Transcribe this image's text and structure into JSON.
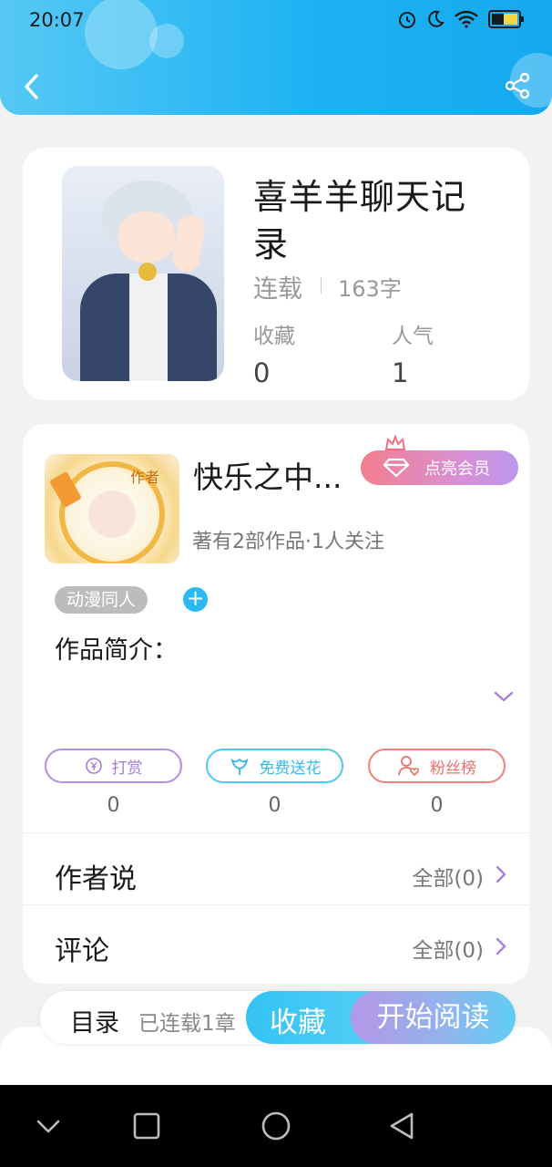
{
  "status_bar": {
    "time": "20:07"
  },
  "book": {
    "title": "喜羊羊聊天记录",
    "status": "连载",
    "word_count": "163字",
    "stats": [
      {
        "label": "收藏",
        "value": "0"
      },
      {
        "label": "人气",
        "value": "1"
      }
    ]
  },
  "author": {
    "name": "快乐之中...",
    "avatar_badge": "作者",
    "vip_label": "点亮会员",
    "meta": "著有2部作品·1人关注",
    "tag": "动漫同人",
    "add_tag_symbol": "+",
    "intro_label": "作品简介："
  },
  "actions": [
    {
      "label": "打赏",
      "count": "0",
      "color": "#a47cd6"
    },
    {
      "label": "免费送花",
      "count": "0",
      "color": "#35b8e6"
    },
    {
      "label": "粉丝榜",
      "count": "0",
      "color": "#ec706a"
    }
  ],
  "rows": [
    {
      "label": "作者说",
      "link": "全部(0)"
    },
    {
      "label": "评论",
      "link": "全部(0)"
    }
  ],
  "bottom_bar": {
    "toc_label": "目录",
    "toc_count": "已连载1章",
    "collect_label": "收藏",
    "read_label": "开始阅读"
  },
  "icons": {
    "header": [
      "back-icon",
      "share-icon"
    ],
    "status": [
      "alarm-icon",
      "moon-icon",
      "wifi-icon",
      "battery-icon"
    ],
    "nav": [
      "nav-down-icon",
      "nav-recent-icon",
      "nav-home-icon",
      "nav-back-icon"
    ]
  },
  "colors": {
    "header_start": "#56c8f4",
    "header_end": "#14a8ef",
    "vip_gradient": [
      "#f47e8e",
      "#bb97ee"
    ],
    "accent_blue": "#29baf2"
  }
}
